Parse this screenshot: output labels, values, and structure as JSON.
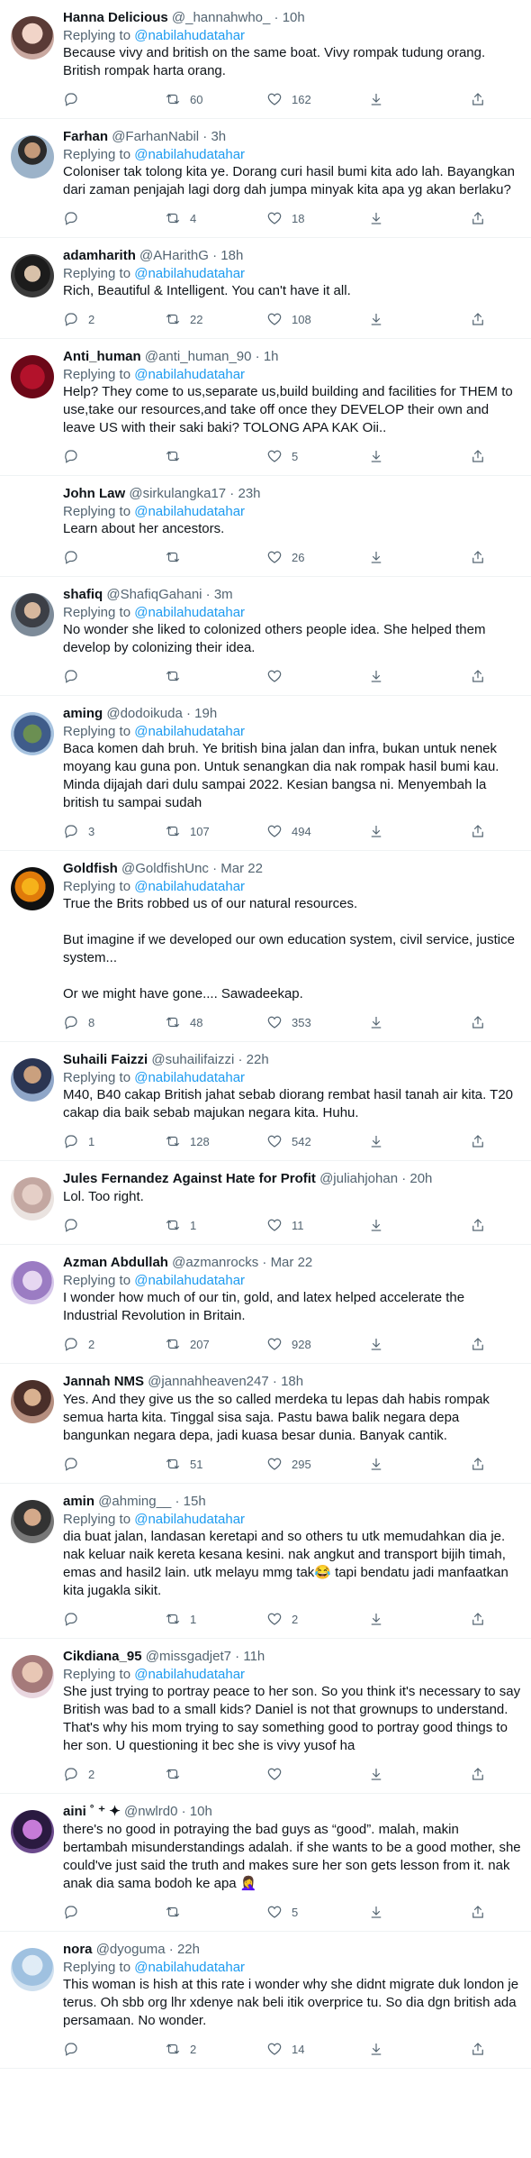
{
  "replying_prefix": "Replying to ",
  "tweets": [
    {
      "name": "Hanna Delicious",
      "handle": "@_hannahwho_",
      "time": "10h",
      "mention": "@nabilahudatahar",
      "text": "Because vivy and british on the same boat. Vivy rompak tudung orang. British rompak harta orang.",
      "replies": "",
      "retweets": "60",
      "likes": "162"
    },
    {
      "name": "Farhan",
      "handle": "@FarhanNabil",
      "time": "3h",
      "mention": "@nabilahudatahar",
      "text": "Coloniser tak tolong kita ye. Dorang curi hasil bumi kita ado lah. Bayangkan dari zaman penjajah lagi dorg dah jumpa minyak kita apa yg akan berlaku?",
      "replies": "",
      "retweets": "4",
      "likes": "18"
    },
    {
      "name": "adamharith",
      "handle": "@AHarithG",
      "time": "18h",
      "mention": "@nabilahudatahar",
      "text": "Rich, Beautiful & Intelligent. You can't have it all.",
      "replies": "2",
      "retweets": "22",
      "likes": "108"
    },
    {
      "name": "Anti_human",
      "handle": "@anti_human_90",
      "time": "1h",
      "mention": "@nabilahudatahar",
      "text": "Help? They come to us,separate us,build building and facilities for THEM to use,take our resources,and take off once they DEVELOP their own and leave US with their saki baki? TOLONG APA KAK Oii..",
      "replies": "",
      "retweets": "",
      "likes": "5"
    },
    {
      "name": "John Law",
      "handle": "@sirkulangka17",
      "time": "23h",
      "mention": "@nabilahudatahar",
      "text": "Learn about her ancestors.",
      "replies": "",
      "retweets": "",
      "likes": "26"
    },
    {
      "name": "shafiq",
      "handle": "@ShafiqGahani",
      "time": "3m",
      "mention": "@nabilahudatahar",
      "text": "No wonder she liked to colonized others people idea. She helped them develop by colonizing their idea.",
      "replies": "",
      "retweets": "",
      "likes": ""
    },
    {
      "name": "aming",
      "handle": "@dodoikuda",
      "time": "19h",
      "mention": "@nabilahudatahar",
      "text": "Baca komen dah bruh. Ye british bina jalan dan infra, bukan untuk nenek moyang kau guna pon. Untuk senangkan dia nak rompak hasil bumi kau. Minda dijajah dari dulu sampai 2022. Kesian bangsa ni. Menyembah la british tu sampai sudah",
      "replies": "3",
      "retweets": "107",
      "likes": "494"
    },
    {
      "name": "Goldfish",
      "handle": "@GoldfishUnc",
      "time": "Mar 22",
      "mention": "@nabilahudatahar",
      "text": "True the Brits robbed us of our natural resources.\n\nBut imagine if we developed our own education system, civil service, justice system...\n\nOr we might have gone.... Sawadeekap.",
      "replies": "8",
      "retweets": "48",
      "likes": "353"
    },
    {
      "name": "Suhaili Faizzi",
      "handle": "@suhailifaizzi",
      "time": "22h",
      "mention": "@nabilahudatahar",
      "text": "M40, B40 cakap British jahat sebab diorang rembat hasil tanah air kita. T20 cakap dia baik sebab majukan negara kita. Huhu.",
      "replies": "1",
      "retweets": "128",
      "likes": "542"
    },
    {
      "name": "Jules Fernandez",
      "name_suffix": "Against Hate for Profit",
      "handle": "@juliahjohan",
      "time": "20h",
      "mention": "",
      "text": "Lol. Too right.",
      "replies": "",
      "retweets": "1",
      "likes": "11"
    },
    {
      "name": "Azman Abdullah",
      "handle": "@azmanrocks",
      "time": "Mar 22",
      "mention": "@nabilahudatahar",
      "text": "I wonder how much of our tin, gold, and latex helped accelerate the Industrial Revolution in Britain.",
      "replies": "2",
      "retweets": "207",
      "likes": "928"
    },
    {
      "name": "Jannah",
      "name_suffix": "NMS",
      "handle": "@jannahheaven247",
      "time": "18h",
      "mention": "",
      "text": "Yes. And they give us the so called merdeka tu lepas dah habis rompak semua harta kita. Tinggal sisa saja. Pastu bawa balik negara depa bangunkan negara depa, jadi kuasa besar dunia. Banyak cantik.",
      "replies": "",
      "retweets": "51",
      "likes": "295"
    },
    {
      "name": "amin",
      "handle": "@ahming__",
      "time": "15h",
      "mention": "@nabilahudatahar",
      "text": "dia buat jalan, landasan keretapi and so others tu utk memudahkan dia je. nak keluar naik kereta kesana kesini. nak angkut and transport bijih timah, emas and hasil2 lain. utk melayu mmg tak😂 tapi bendatu jadi manfaatkan kita jugakla sikit.",
      "replies": "",
      "retweets": "1",
      "likes": "2"
    },
    {
      "name": "Cikdiana_95",
      "handle": "@missgadjet7",
      "time": "11h",
      "mention": "@nabilahudatahar",
      "text": "She just trying to portray peace to her son. So you think it's necessary to say British was bad to a small kids? Daniel is not that grownups to understand. That's why his mom trying to say something good to portray good things to her son. U questioning it bec she is vivy yusof ha",
      "replies": "2",
      "retweets": "",
      "likes": ""
    },
    {
      "name": "aini",
      "name_suffix": "˚ ⁺ ✦",
      "handle": "@nwlrd0",
      "time": "10h",
      "mention": "",
      "text": "there's no good in potraying the bad guys as “good”. malah, makin bertambah misunderstandings adalah. if she wants to be a good mother, she could've just said the truth and makes sure her son gets lesson from it. nak anak dia sama bodoh ke apa 🤦‍♀️",
      "replies": "",
      "retweets": "",
      "likes": "5"
    },
    {
      "name": "nora",
      "handle": "@dyoguma",
      "time": "22h",
      "mention": "@nabilahudatahar",
      "text": "This woman is hish at this rate i wonder why she didnt migrate duk london je terus. Oh sbb org lhr xdenye nak beli itik overprice tu. So dia dgn british ada persamaan. No wonder.",
      "replies": "",
      "retweets": "2",
      "likes": "14"
    }
  ]
}
